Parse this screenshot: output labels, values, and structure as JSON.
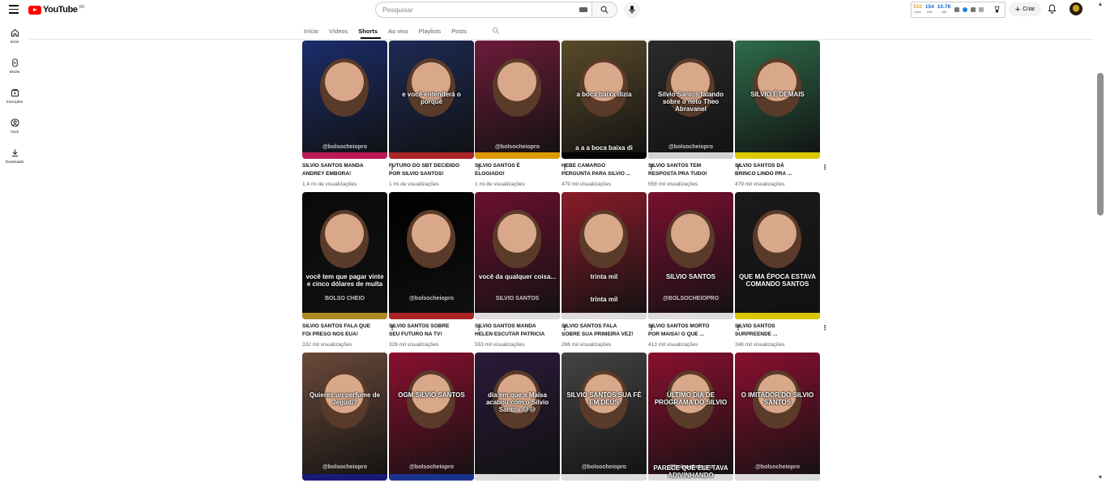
{
  "header": {
    "logo_text": "YouTube",
    "region": "BR",
    "search_placeholder": "Pesquisar",
    "create_label": "Criar",
    "ext": {
      "a_value": "510",
      "a_label": "Likes",
      "b_value": "154",
      "b_label": "60m",
      "c_value": "10.7K",
      "c_label": "48h"
    }
  },
  "sidebar": {
    "items": [
      {
        "label": "Início",
        "icon": "home-icon"
      },
      {
        "label": "Shorts",
        "icon": "shorts-icon"
      },
      {
        "label": "Inscrições",
        "icon": "subscriptions-icon"
      },
      {
        "label": "Você",
        "icon": "you-icon"
      },
      {
        "label": "Downloads",
        "icon": "download-icon"
      }
    ]
  },
  "tabs": [
    {
      "label": "Início"
    },
    {
      "label": "Vídeos"
    },
    {
      "label": "Shorts",
      "active": true
    },
    {
      "label": "Ao vivo"
    },
    {
      "label": "Playlists"
    },
    {
      "label": "Posts"
    }
  ],
  "shorts": [
    {
      "title1": "SILVIO SANTOS MANDA",
      "title2": "ANDREY EMBORA!",
      "views": "1,4 mi de visualizações",
      "cap": "",
      "handle": "@bolsocheiopro",
      "bg": "#1b2d6b",
      "accent": "#d81b60"
    },
    {
      "title1": "FUTURO DO SBT DECIDIDO",
      "title2": "POR SILVIO SANTOS!",
      "views": "1 mi de visualizações",
      "cap": "e você entenderá o porquê",
      "handle": "",
      "bg": "#1d2a55",
      "accent": "#c62828"
    },
    {
      "title1": "SILVIO SANTOS É",
      "title2": "ELOGIADO!",
      "views": "1 mi de visualizações",
      "cap": "",
      "handle": "@bolsocheiopro",
      "bg": "#6d1b3a",
      "accent": "#ffb300"
    },
    {
      "title1": "HEBE CAMARGO",
      "title2": "PERGUNTA PARA SILVIO ...",
      "views": "479 mil visualizações",
      "cap": "a boca baixa dizia",
      "cap2": "a a a boca baixa di",
      "handle": "",
      "bg": "#5a4a2a",
      "accent": "#000000"
    },
    {
      "title1": "SILVIO SANTOS TEM",
      "title2": "RESPOSTA PRA TUDO!",
      "views": "658 mil visualizações",
      "cap": "Silvio Santos falando sobre o neto Theo Abravanel",
      "handle": "@bolsocheiopro",
      "bg": "#2b2b2b",
      "accent": "#f5f5f5"
    },
    {
      "title1": "SILVIO SANTOS DÁ",
      "title2": "BRINCO LINDO PRA ...",
      "views": "479 mil visualizações",
      "cap": "SILVIO É DEMAIS",
      "handle": "",
      "bg": "#2e6b4a",
      "accent": "#ffe600"
    },
    {
      "title1": "SILVIO SANTOS FALA QUE",
      "title2": "FOI PRESO NOS EUA!",
      "views": "332 mil visualizações",
      "cap": "você tem que pagar vinte e cinco dólares de multa",
      "handle": "BOLSO CHEIO",
      "bg": "#0a0a0a",
      "accent": "#c9a227"
    },
    {
      "title1": "SILVIO SANTOS SOBRE",
      "title2": "SEU FUTURO NA TV!",
      "views": "326 mil visualizações",
      "cap": "",
      "handle": "@bolsocheiopro",
      "bg": "#000000",
      "accent": "#c62828"
    },
    {
      "title1": "SILVIO SANTOS MANDA",
      "title2": "HELEN ESCUTAR PATRICIA",
      "views": "553 mil visualizações",
      "cap": "você da qualquer coisa...",
      "handle": "SILVIO SANTOS",
      "bg": "#6a1030",
      "accent": "#ffffff"
    },
    {
      "title1": "SILVIO SANTOS FALA",
      "title2": "SOBRE SUA PRIMEIRA VEZ!",
      "views": "266 mil visualizações",
      "cap": "trinta mil",
      "cap2": "trinta mil",
      "handle": "",
      "bg": "#8a1c2a",
      "accent": "#ffffff"
    },
    {
      "title1": "SILVIO SANTOS MORTO",
      "title2": "POR MAISA! O QUE ...",
      "views": "413 mil visualizações",
      "cap": "SILVIO SANTOS",
      "handle": "@BOLSOCHEIOPRO",
      "bg": "#7a1030",
      "accent": "#ffffff"
    },
    {
      "title1": "SILVIO SANTOS",
      "title2": "SURPREENDE ...",
      "views": "246 mil visualizações",
      "cap": "QUE MA ÉPOCA ESTAVA COMANDO SANTOS",
      "handle": "",
      "bg": "#1a1a1a",
      "accent": "#ffe600"
    },
    {
      "title1": "",
      "title2": "",
      "views": "",
      "cap": "Quieres un perfume de Jeguiti?",
      "handle": "@bolsocheiopro",
      "bg": "#6b4a3a",
      "accent": "#1a1a8a"
    },
    {
      "title1": "",
      "title2": "",
      "views": "",
      "cap": "OGM SILVIO SANTOS",
      "handle": "@bolsocheiopro",
      "bg": "#8a1030",
      "accent": "#1a3aa0"
    },
    {
      "title1": "",
      "title2": "",
      "views": "",
      "cap": "dia em que a Maisa acabou com o Silvio Santos 😅😅",
      "handle": "",
      "bg": "#2a1a3a",
      "accent": "#ffffff"
    },
    {
      "title1": "",
      "title2": "",
      "views": "",
      "cap": "SILVIO SANTOS SUA FÉ EM DEUS",
      "handle": "@bolsocheiopro",
      "bg": "#444444",
      "accent": "#ffffff"
    },
    {
      "title1": "",
      "title2": "",
      "views": "",
      "cap": "ÚLTIMO DIA DE PROGRAMA DO SILVIO",
      "cap2": "PARECE QUE ELE TAVA ADIVINHANDO",
      "handle": "@bolsocheiopro",
      "bg": "#8a1030",
      "accent": "#ffffff"
    },
    {
      "title1": "",
      "title2": "",
      "views": "",
      "cap": "O IMITADOR DO SILVIO SANTOS",
      "handle": "@bolsocheiopro",
      "bg": "#8a1030",
      "accent": "#ffffff"
    }
  ]
}
